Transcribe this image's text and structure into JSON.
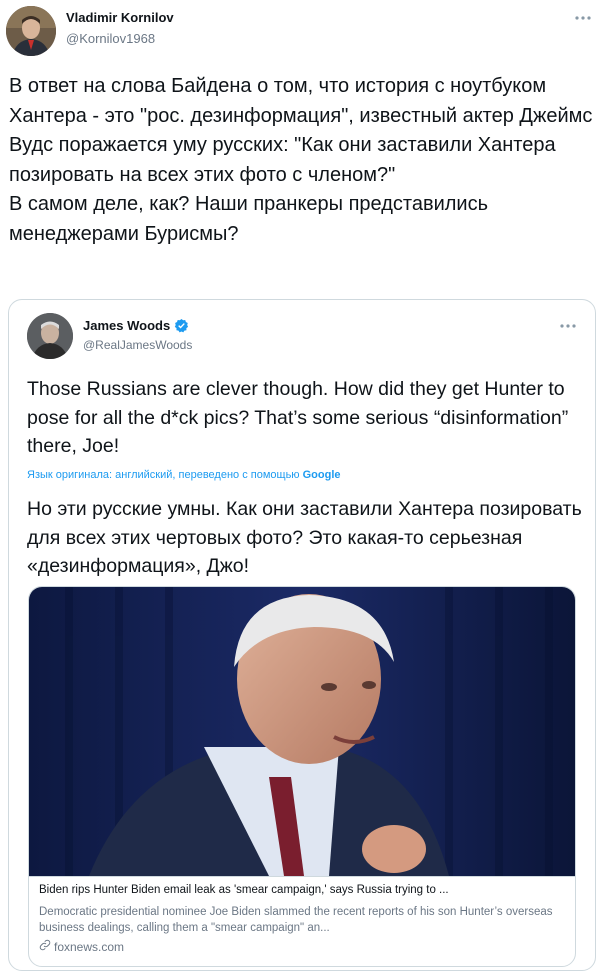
{
  "author": {
    "name": "Vladimir Kornilov",
    "handle": "@Kornilov1968"
  },
  "tweet_text": "В ответ на слова Байдена о том, что история с ноутбуком Хантера - это \"рос. дезинформация\", известный актер Джеймс Вудс поражается уму русских: \"Как они заставили Хантера позировать на всех этих фото с членом?\"\nВ самом деле, как? Наши пранкеры представились менеджерами Бурисмы?",
  "quoted": {
    "name": "James Woods",
    "handle": "@RealJamesWoods",
    "text": "Those Russians are clever though. How did they get Hunter to pose for all the d*ck pics? That’s some serious “disinformation” there, Joe!",
    "translation_note": "Язык оригинала: английский, переведено с помощью",
    "translation_provider": "Google",
    "translated_text": "Но эти русские умны. Как они заставили Хантера позировать для всех этих чертовых фото? Это какая-то серьезная «дезинформация», Джо!",
    "card": {
      "title": "Biden rips Hunter Biden email leak as 'smear campaign,' says Russia trying to ...",
      "description": "Democratic presidential nominee Joe Biden slammed the recent reports of his son Hunter’s overseas business dealings, calling them a \"smear campaign\" an...",
      "domain": "foxnews.com"
    }
  },
  "icons": {
    "more": "more-options-icon",
    "verified": "verified-badge-icon",
    "link": "link-icon"
  },
  "colors": {
    "accent": "#1d9bf0",
    "muted": "#6b7785",
    "border": "#cfd9de"
  }
}
